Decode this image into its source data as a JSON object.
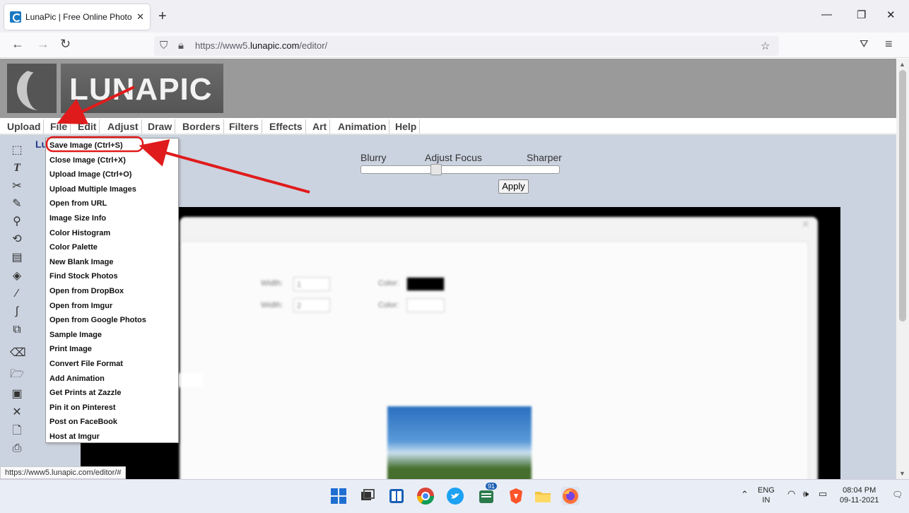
{
  "browser": {
    "tab_title": "LunaPic | Free Online Photo Edi",
    "tab_close": "✕",
    "new_tab": "+",
    "url_prefix": "https://www5.",
    "url_domain": "lunapic.com",
    "url_path": "/editor/",
    "status_url": "https://www5.lunapic.com/editor/#"
  },
  "page": {
    "logo_text": "LUNAPIC",
    "lu_text": "Lu",
    "menu": [
      "Upload",
      "File",
      "Edit",
      "Adjust",
      "Draw",
      "Borders",
      "Filters",
      "Effects",
      "Art",
      "Animation",
      "Help"
    ],
    "file_menu_items": [
      "Save Image (Ctrl+S)",
      "Close Image (Ctrl+X)",
      "Upload Image (Ctrl+O)",
      "Upload Multiple Images",
      "Open from URL",
      "Image Size Info",
      "Color Histogram",
      "Color Palette",
      "New Blank Image",
      "Find Stock Photos",
      "Open from DropBox",
      "Open from Imgur",
      "Open from Google Photos",
      "Sample Image",
      "Print Image",
      "Convert File Format",
      "Add Animation",
      "Get Prints at Zazzle",
      "Pin it on Pinterest",
      "Post on FaceBook",
      "Host at Imgur"
    ],
    "focus": {
      "left_label": "Blurry",
      "center_label": "Adjust Focus",
      "right_label": "Sharper",
      "value_fraction": 0.37,
      "apply_label": "Apply"
    },
    "dialog": {
      "width_label": "Width:",
      "color_label": "Color:",
      "width_value_1": "1",
      "width_value_2": "2"
    }
  },
  "taskbar": {
    "badge_count": "91",
    "lang_top": "ENG",
    "lang_bottom": "IN",
    "time": "08:04 PM",
    "date": "09-11-2021"
  },
  "colors": {
    "annotation_red": "#e01b1b",
    "menu_text": "#444444"
  }
}
